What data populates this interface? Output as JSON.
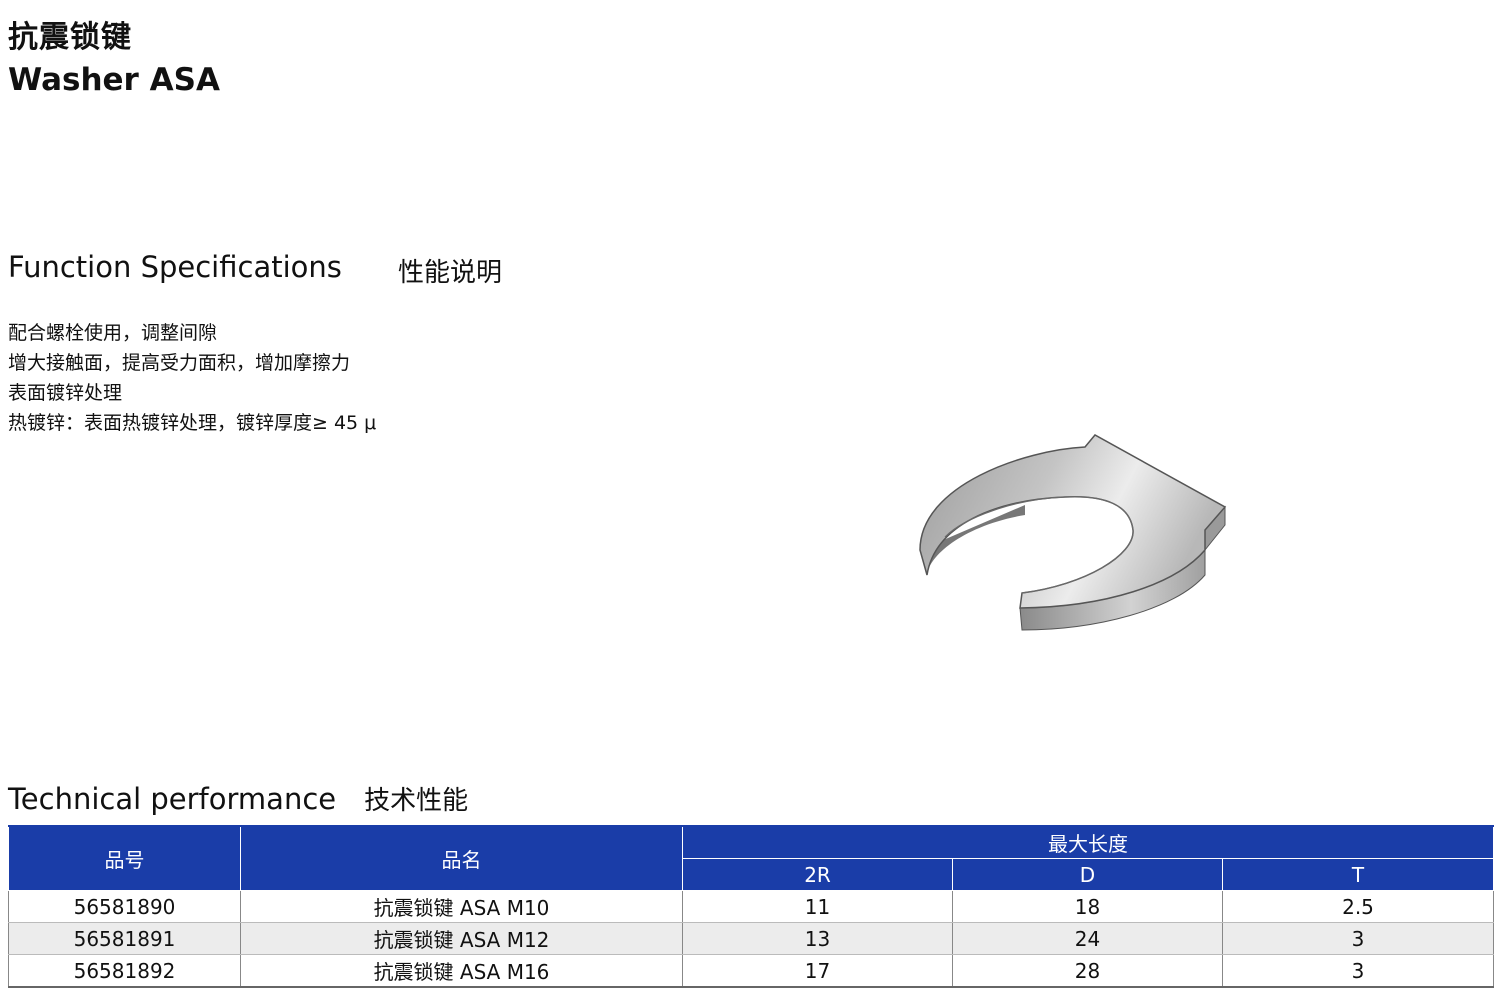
{
  "header": {
    "title_cn": "抗震锁键",
    "title_en": "Washer ASA"
  },
  "function_section": {
    "title_en": "Function Specifications",
    "title_cn": "性能说明",
    "items": [
      "配合螺栓使用，调整间隙",
      "增大接触面，提高受力面积，增加摩擦力",
      "表面镀锌处理",
      "热镀锌：表面热镀锌处理，镀锌厚度≥ 45 μ"
    ]
  },
  "technical_section": {
    "title_en": "Technical performance",
    "title_cn": "技术性能"
  },
  "table": {
    "headers": {
      "part_no": "品号",
      "name": "品名",
      "max_length": "最大长度",
      "sub": [
        "2R",
        "D",
        "T"
      ]
    },
    "rows": [
      [
        "56581890",
        "抗震锁键 ASA M10",
        "11",
        "18",
        "2.5"
      ],
      [
        "56581891",
        "抗震锁键 ASA M12",
        "13",
        "24",
        "3"
      ],
      [
        "56581892",
        "抗震锁键 ASA M16",
        "17",
        "28",
        "3"
      ]
    ],
    "header_color": "#1a3da8"
  }
}
